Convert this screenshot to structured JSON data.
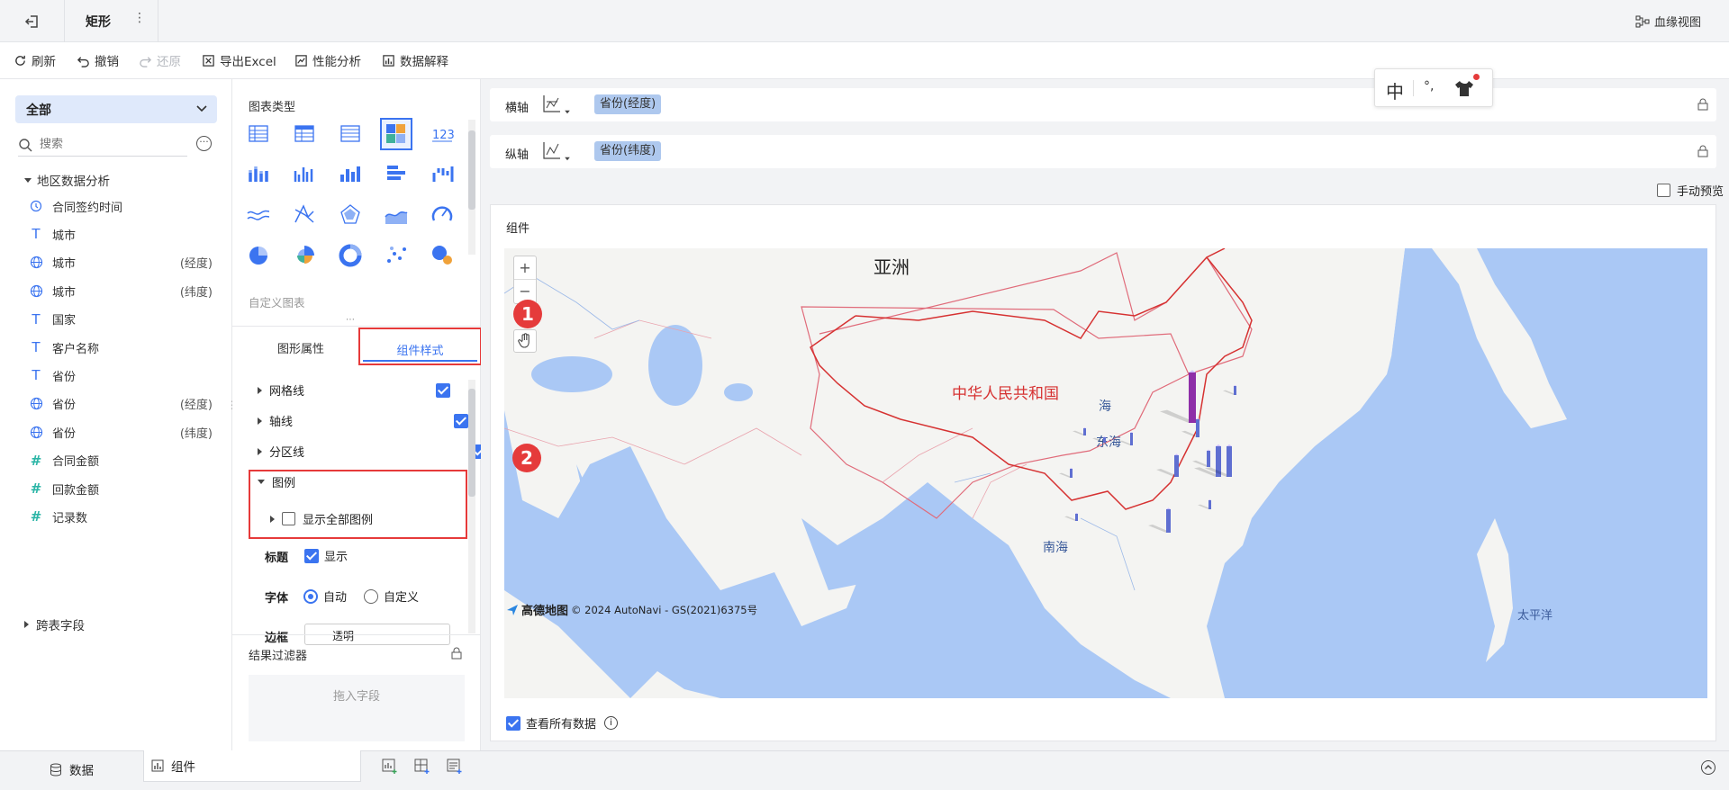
{
  "topbar": {
    "title": "矩形",
    "lineage_label": "血缘视图"
  },
  "toolbar": {
    "refresh": "刷新",
    "undo": "撤销",
    "redo": "还原",
    "export_excel": "导出Excel",
    "perf": "性能分析",
    "explain": "数据解释"
  },
  "left": {
    "dropdown_value": "全部",
    "search_placeholder": "搜索",
    "group1": "地区数据分析",
    "fields": [
      {
        "icon": "clock",
        "label": "合同签约时间",
        "sub": ""
      },
      {
        "icon": "text",
        "label": "城市",
        "sub": ""
      },
      {
        "icon": "globe",
        "label": "城市",
        "sub": "(经度)"
      },
      {
        "icon": "globe",
        "label": "城市",
        "sub": "(纬度)"
      },
      {
        "icon": "text",
        "label": "国家",
        "sub": ""
      },
      {
        "icon": "text",
        "label": "客户名称",
        "sub": ""
      },
      {
        "icon": "text",
        "label": "省份",
        "sub": ""
      },
      {
        "icon": "globe",
        "label": "省份",
        "sub": "(经度)"
      },
      {
        "icon": "globe",
        "label": "省份",
        "sub": "(纬度)"
      },
      {
        "icon": "hash",
        "label": "合同金额",
        "sub": ""
      },
      {
        "icon": "hash",
        "label": "回款金额",
        "sub": ""
      },
      {
        "icon": "hash",
        "label": "记录数",
        "sub": ""
      }
    ],
    "group2": "跨表字段"
  },
  "mid": {
    "chart_type_title": "图表类型",
    "custom_chart": "自定义图表",
    "tab_props": "图形属性",
    "tab_style": "组件样式",
    "gridline": "网格线",
    "axis": "轴线",
    "divider": "分区线",
    "legend": "图例",
    "show_all_legend": "显示全部图例",
    "title_label": "标题",
    "title_show": "显示",
    "font_label": "字体",
    "font_auto": "自动",
    "font_custom": "自定义",
    "border_label": "边框",
    "border_value": "透明",
    "filter_title": "结果过滤器",
    "drop_field": "拖入字段"
  },
  "main": {
    "x_axis_label": "横轴",
    "x_axis_value": "省份(经度)",
    "y_axis_label": "纵轴",
    "y_axis_value": "省份(纬度)",
    "manual_preview": "手动预览",
    "component_title": "组件",
    "view_all_data": "查看所有数据",
    "ime": {
      "zh": "中"
    }
  },
  "map": {
    "asia": "亚洲",
    "china": "中华人民共和国",
    "yellow_sea": "海",
    "east_sea": "东海",
    "south_sea": "南海",
    "pacific": "太平洋",
    "brand": "高德地图",
    "copyright": "© 2024 AutoNavi - GS(2021)6375号",
    "zoom_in": "+",
    "zoom_out": "−",
    "badge1": "1",
    "badge2": "2"
  },
  "bottom": {
    "data_tab": "数据",
    "component_tab": "组件"
  },
  "colors": {
    "accent": "#3b74f0",
    "highlight_red": "#e63a3a",
    "badge_red": "#e53b3b",
    "pill": "#aec8ee",
    "ocean": "#aac8f5",
    "land": "#f4f4f2",
    "bar_purple": "#8e2fa8",
    "bar_blue": "#5f6fd1"
  }
}
